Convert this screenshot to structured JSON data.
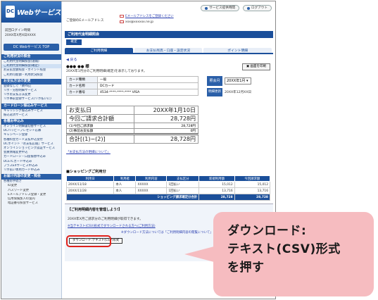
{
  "app": {
    "logo_mark": "DC",
    "logo_text": "Webサービス"
  },
  "sidebar": {
    "last_login_label": "前回ログイン時間",
    "last_login_value": "20XX年X月X日XXXX",
    "top_button": "DC Webサービス TOP",
    "sections": [
      {
        "title": "ご利用状況の照会",
        "items": [
          "ご利用代金明細照会(速報)",
          "ご利用代金明細照会(確定)",
          "お支払金額照会・ポイント照会",
          "ご利用可能額・利用状況照会"
        ]
      },
      {
        "title": "お支払方法の変更",
        "items": [
          "登録なしで「楽Pay」",
          "リボ・分割明細サービス",
          "リボお支払方法変更",
          "リボ事前登録サービス(リボ払いに)"
        ]
      },
      {
        "title": "カードローン振込みサービス",
        "items": [
          "キャッシング振込みサービス",
          "振込返済サービス"
        ]
      },
      {
        "title": "各種お申込み",
        "items": [
          "オンライン明細書切替サービス",
          "DCハッピープレゼント応募",
          "キャンペーン登録",
          "各種料金カード支払申込受付",
          "DCポイント「お支払応援」サービス",
          "オンラインショッピング認証サービス",
          "会員情報変更申込",
          "カードローン・口座振替申込み",
          "DCETCカード申込み",
          "プラスEXサービス申込み",
          "リボ払い専用カード申込み"
        ]
      },
      {
        "title": "お届け内容の変更・照会",
        "items": [
          "各種お手続き"
        ],
        "subitems": [
          "ID変更",
          "パスワード変更",
          "Eメールアドレス登録・変更",
          "信用保険加入の案内",
          "暗証番号照会サービス"
        ]
      }
    ]
  },
  "header": {
    "service_hours": "サービス提供時間",
    "logout": "ログアウト",
    "mail_label": "ご登録のEメールアドレス",
    "mail_link": "Eメールアドレスをご登録ください",
    "mail_address": "xxx@xxxxxx.ne.jp"
  },
  "page": {
    "title": "ご利用代金明細照会",
    "status_badge": "確定",
    "tabs": [
      "ご利用明細",
      "お支払残高・口座・設定状況",
      "ポイント明細"
    ],
    "back": "戻る",
    "customer_name": "●●● ●● 様",
    "statement_note": "20XX年1月分のご利用明細(確定)を表示しております。",
    "print_button": "画面を印刷"
  },
  "card": {
    "rows": [
      {
        "key": "カード種類",
        "value": "一般"
      },
      {
        "key": "カード名称",
        "value": "DCカード"
      },
      {
        "key": "カード番号",
        "value": "4534-****-****-**** VISA"
      }
    ]
  },
  "inquiry": {
    "label": "照会月",
    "selected_month": "20XX年1月",
    "updated_label": "明細更新日",
    "updated_value": "20XX年12月XX日"
  },
  "payment": {
    "due_label": "お支払日",
    "due_value": "20XX年1月10日",
    "total_label": "今回ご請求合計額",
    "total_value": "28,728円",
    "sub1_label": "(1)今回ご請求額",
    "sub1_value": "28,728円",
    "sub2_label": "(2)事前お支払額",
    "sub2_value": "0円",
    "sum_label": "合計[(1)−(2)]",
    "sum_value": "28,728円",
    "link": "「お支払方法の明細について」"
  },
  "shopping": {
    "heading": "■ショッピングご利用分",
    "columns": [
      "利用日",
      "利用者",
      "利用内容",
      "支払区分",
      "新規利用額",
      "今回請求額"
    ],
    "rows": [
      [
        "20XX/11/18",
        "本人",
        "XXXXX",
        "1回払い",
        "15,012",
        "15,012"
      ],
      [
        "20XX/11/28",
        "本人",
        "XXXXX",
        "1回払い",
        "13,716",
        "13,716"
      ]
    ],
    "total_label": "ショッピング請求確定分合計",
    "total_new": "28,728",
    "total_billed": "28,728"
  },
  "download": {
    "heading": "【ご利用明細内容を管理しよう!】",
    "text": "20XX年X月ご請求分のご利用明細が取得できます。",
    "link1": "※当テキスト(CSV)形式でダウンロードされる方へ(ご利用方法)",
    "link2": "※ダウンロード方法については「ご利用明細内容の閲覧について」をご参照下さい。",
    "button": "ダウンロード:テキスト(CSV)形式"
  },
  "callout": {
    "lines": [
      "ダウンロード:",
      "テキスト(CSV)形式",
      "を押す"
    ]
  },
  "colors": {
    "brand": "#1b4f9a",
    "highlight": "#e0221c",
    "callout_bg": "#f6bcc0"
  }
}
